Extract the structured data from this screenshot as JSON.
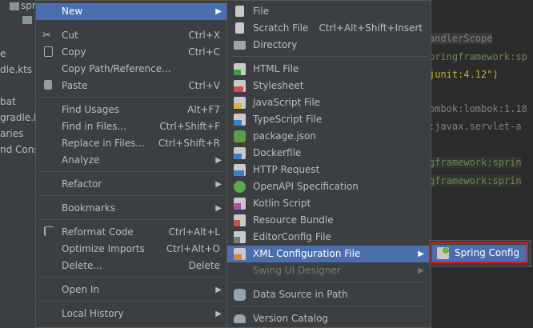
{
  "project_tree": {
    "items": [
      "spr",
      "e",
      "dle.kts",
      "bat",
      "gradle.kt",
      "aries",
      "nd Conso"
    ]
  },
  "editor": {
    "lines": [
      {
        "text": "andlerScope",
        "color": "#808080"
      },
      {
        "text": "pringframework:sp",
        "color": "#6a8759"
      },
      {
        "text": " junit:4.12\")",
        "color": "#bbb529"
      },
      {
        "text": "ombok:lombok:1.18",
        "color": "#808080"
      },
      {
        "text": ":javax.servlet-a",
        "color": "#808080"
      },
      {
        "text": "gframework:sprin",
        "color": "#6a8759"
      },
      {
        "text": "gframework:sprin",
        "color": "#6a8759"
      }
    ]
  },
  "menu1": {
    "items": [
      {
        "label": "New",
        "selected": true,
        "submenu": true
      },
      {
        "label": "Cut",
        "shortcut": "Ctrl+X",
        "icon": "scissors-icon"
      },
      {
        "label": "Copy",
        "shortcut": "Ctrl+C",
        "icon": "copy-icon"
      },
      {
        "label": "Copy Path/Reference..."
      },
      {
        "label": "Paste",
        "shortcut": "Ctrl+V",
        "icon": "paste-icon"
      },
      {
        "label": "Find Usages",
        "shortcut": "Alt+F7"
      },
      {
        "label": "Find in Files...",
        "shortcut": "Ctrl+Shift+F"
      },
      {
        "label": "Replace in Files...",
        "shortcut": "Ctrl+Shift+R"
      },
      {
        "label": "Analyze",
        "submenu": true
      },
      {
        "label": "Refactor",
        "submenu": true
      },
      {
        "label": "Bookmarks",
        "submenu": true
      },
      {
        "label": "Reformat Code",
        "shortcut": "Ctrl+Alt+L",
        "icon": "reformat-icon"
      },
      {
        "label": "Optimize Imports",
        "shortcut": "Ctrl+Alt+O"
      },
      {
        "label": "Delete...",
        "shortcut": "Delete"
      },
      {
        "label": "Open In",
        "submenu": true
      },
      {
        "label": "Local History",
        "submenu": true
      }
    ]
  },
  "menu2": {
    "items": [
      {
        "label": "File",
        "icon": "file-icon"
      },
      {
        "label": "Scratch File",
        "shortcut": "Ctrl+Alt+Shift+Insert",
        "icon": "scratch-file-icon"
      },
      {
        "label": "Directory",
        "icon": "folder-icon"
      },
      {
        "label": "HTML File",
        "icon": "html-file-icon"
      },
      {
        "label": "Stylesheet",
        "icon": "css-file-icon"
      },
      {
        "label": "JavaScript File",
        "icon": "javascript-file-icon"
      },
      {
        "label": "TypeScript File",
        "icon": "typescript-file-icon"
      },
      {
        "label": "package.json",
        "icon": "nodejs-icon"
      },
      {
        "label": "Dockerfile",
        "icon": "docker-icon"
      },
      {
        "label": "HTTP Request",
        "icon": "api-icon"
      },
      {
        "label": "OpenAPI Specification",
        "icon": "openapi-icon"
      },
      {
        "label": "Kotlin Script",
        "icon": "kotlin-icon"
      },
      {
        "label": "Resource Bundle",
        "icon": "resource-bundle-icon"
      },
      {
        "label": "EditorConfig File",
        "icon": "editorconfig-icon"
      },
      {
        "label": "XML Configuration File",
        "icon": "xml-file-icon",
        "selected": true,
        "submenu": true
      },
      {
        "label": "Swing UI Designer",
        "disabled": true,
        "submenu": true
      },
      {
        "label": "Data Source in Path",
        "icon": "database-icon"
      },
      {
        "label": "Version Catalog",
        "icon": "elephant-icon"
      }
    ]
  },
  "menu3": {
    "items": [
      {
        "label": "Spring Config",
        "icon": "spring-icon",
        "selected": true
      }
    ],
    "highlight_color": "#e0151d"
  },
  "colors": {
    "selection": "#4b6eaf",
    "menu_bg": "#3c3f41"
  }
}
